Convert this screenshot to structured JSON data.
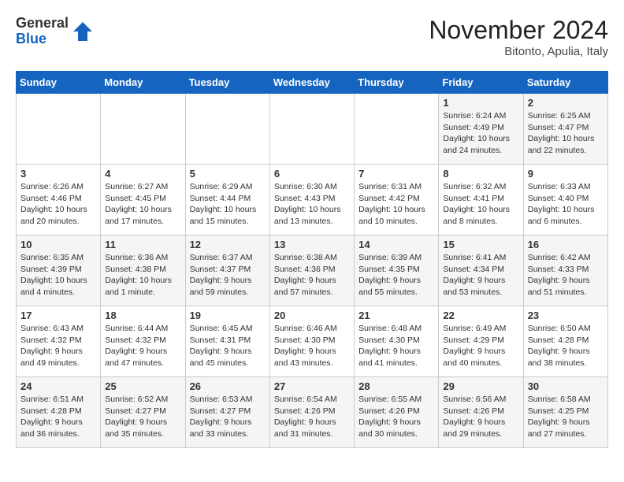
{
  "header": {
    "logo_line1": "General",
    "logo_line2": "Blue",
    "month": "November 2024",
    "location": "Bitonto, Apulia, Italy"
  },
  "weekdays": [
    "Sunday",
    "Monday",
    "Tuesday",
    "Wednesday",
    "Thursday",
    "Friday",
    "Saturday"
  ],
  "weeks": [
    [
      {
        "day": "",
        "detail": ""
      },
      {
        "day": "",
        "detail": ""
      },
      {
        "day": "",
        "detail": ""
      },
      {
        "day": "",
        "detail": ""
      },
      {
        "day": "",
        "detail": ""
      },
      {
        "day": "1",
        "detail": "Sunrise: 6:24 AM\nSunset: 4:49 PM\nDaylight: 10 hours\nand 24 minutes."
      },
      {
        "day": "2",
        "detail": "Sunrise: 6:25 AM\nSunset: 4:47 PM\nDaylight: 10 hours\nand 22 minutes."
      }
    ],
    [
      {
        "day": "3",
        "detail": "Sunrise: 6:26 AM\nSunset: 4:46 PM\nDaylight: 10 hours\nand 20 minutes."
      },
      {
        "day": "4",
        "detail": "Sunrise: 6:27 AM\nSunset: 4:45 PM\nDaylight: 10 hours\nand 17 minutes."
      },
      {
        "day": "5",
        "detail": "Sunrise: 6:29 AM\nSunset: 4:44 PM\nDaylight: 10 hours\nand 15 minutes."
      },
      {
        "day": "6",
        "detail": "Sunrise: 6:30 AM\nSunset: 4:43 PM\nDaylight: 10 hours\nand 13 minutes."
      },
      {
        "day": "7",
        "detail": "Sunrise: 6:31 AM\nSunset: 4:42 PM\nDaylight: 10 hours\nand 10 minutes."
      },
      {
        "day": "8",
        "detail": "Sunrise: 6:32 AM\nSunset: 4:41 PM\nDaylight: 10 hours\nand 8 minutes."
      },
      {
        "day": "9",
        "detail": "Sunrise: 6:33 AM\nSunset: 4:40 PM\nDaylight: 10 hours\nand 6 minutes."
      }
    ],
    [
      {
        "day": "10",
        "detail": "Sunrise: 6:35 AM\nSunset: 4:39 PM\nDaylight: 10 hours\nand 4 minutes."
      },
      {
        "day": "11",
        "detail": "Sunrise: 6:36 AM\nSunset: 4:38 PM\nDaylight: 10 hours\nand 1 minute."
      },
      {
        "day": "12",
        "detail": "Sunrise: 6:37 AM\nSunset: 4:37 PM\nDaylight: 9 hours\nand 59 minutes."
      },
      {
        "day": "13",
        "detail": "Sunrise: 6:38 AM\nSunset: 4:36 PM\nDaylight: 9 hours\nand 57 minutes."
      },
      {
        "day": "14",
        "detail": "Sunrise: 6:39 AM\nSunset: 4:35 PM\nDaylight: 9 hours\nand 55 minutes."
      },
      {
        "day": "15",
        "detail": "Sunrise: 6:41 AM\nSunset: 4:34 PM\nDaylight: 9 hours\nand 53 minutes."
      },
      {
        "day": "16",
        "detail": "Sunrise: 6:42 AM\nSunset: 4:33 PM\nDaylight: 9 hours\nand 51 minutes."
      }
    ],
    [
      {
        "day": "17",
        "detail": "Sunrise: 6:43 AM\nSunset: 4:32 PM\nDaylight: 9 hours\nand 49 minutes."
      },
      {
        "day": "18",
        "detail": "Sunrise: 6:44 AM\nSunset: 4:32 PM\nDaylight: 9 hours\nand 47 minutes."
      },
      {
        "day": "19",
        "detail": "Sunrise: 6:45 AM\nSunset: 4:31 PM\nDaylight: 9 hours\nand 45 minutes."
      },
      {
        "day": "20",
        "detail": "Sunrise: 6:46 AM\nSunset: 4:30 PM\nDaylight: 9 hours\nand 43 minutes."
      },
      {
        "day": "21",
        "detail": "Sunrise: 6:48 AM\nSunset: 4:30 PM\nDaylight: 9 hours\nand 41 minutes."
      },
      {
        "day": "22",
        "detail": "Sunrise: 6:49 AM\nSunset: 4:29 PM\nDaylight: 9 hours\nand 40 minutes."
      },
      {
        "day": "23",
        "detail": "Sunrise: 6:50 AM\nSunset: 4:28 PM\nDaylight: 9 hours\nand 38 minutes."
      }
    ],
    [
      {
        "day": "24",
        "detail": "Sunrise: 6:51 AM\nSunset: 4:28 PM\nDaylight: 9 hours\nand 36 minutes."
      },
      {
        "day": "25",
        "detail": "Sunrise: 6:52 AM\nSunset: 4:27 PM\nDaylight: 9 hours\nand 35 minutes."
      },
      {
        "day": "26",
        "detail": "Sunrise: 6:53 AM\nSunset: 4:27 PM\nDaylight: 9 hours\nand 33 minutes."
      },
      {
        "day": "27",
        "detail": "Sunrise: 6:54 AM\nSunset: 4:26 PM\nDaylight: 9 hours\nand 31 minutes."
      },
      {
        "day": "28",
        "detail": "Sunrise: 6:55 AM\nSunset: 4:26 PM\nDaylight: 9 hours\nand 30 minutes."
      },
      {
        "day": "29",
        "detail": "Sunrise: 6:56 AM\nSunset: 4:26 PM\nDaylight: 9 hours\nand 29 minutes."
      },
      {
        "day": "30",
        "detail": "Sunrise: 6:58 AM\nSunset: 4:25 PM\nDaylight: 9 hours\nand 27 minutes."
      }
    ]
  ]
}
